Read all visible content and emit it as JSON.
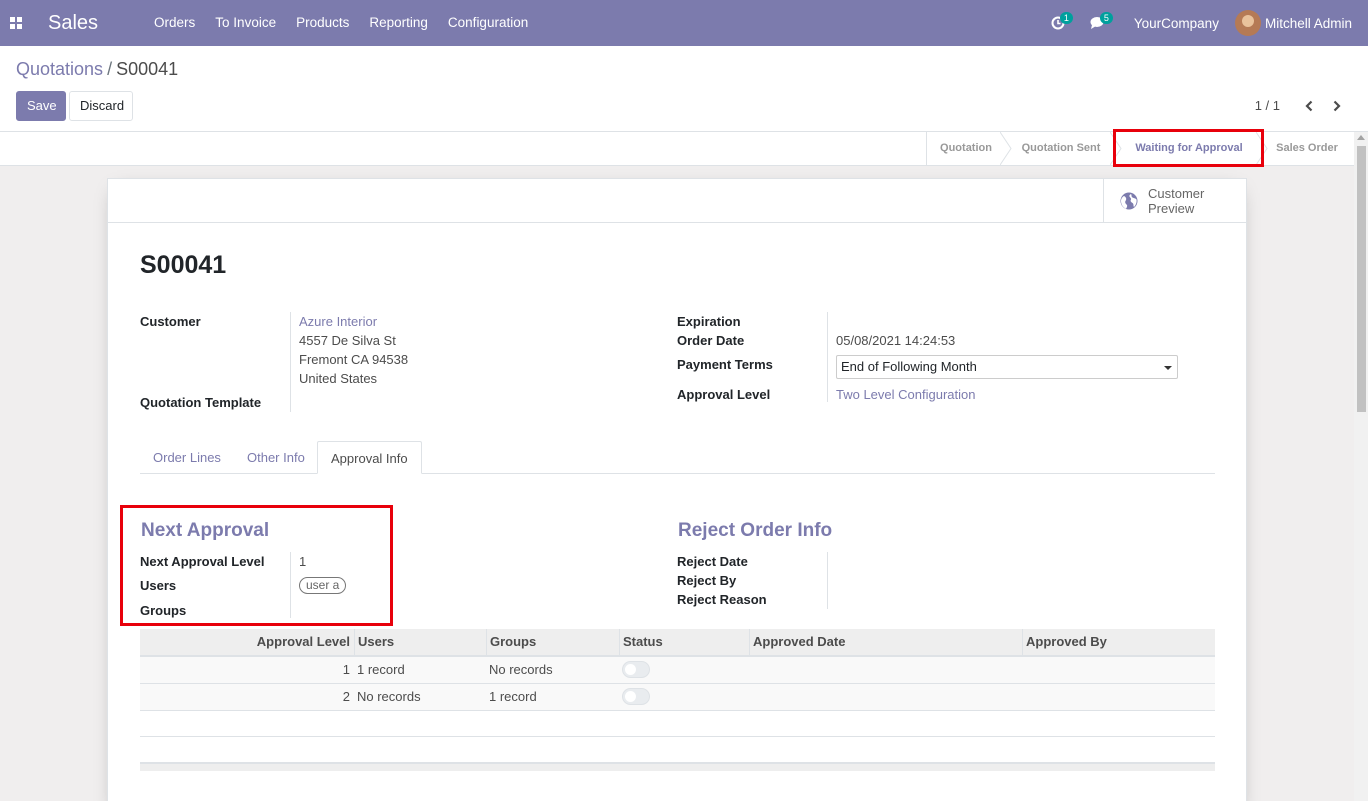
{
  "navbar": {
    "app_name": "Sales",
    "menu": [
      "Orders",
      "To Invoice",
      "Products",
      "Reporting",
      "Configuration"
    ],
    "activity_count": "1",
    "message_count": "5",
    "company": "YourCompany",
    "user": "Mitchell Admin",
    "brand_color": "#7c7bad"
  },
  "breadcrumb": {
    "parent": "Quotations",
    "separator": "/",
    "current": "S00041"
  },
  "buttons": {
    "save": "Save",
    "discard": "Discard"
  },
  "pager": {
    "value": "1 / 1"
  },
  "statusbar": {
    "steps": [
      "Quotation",
      "Quotation Sent",
      "Waiting for Approval",
      "Sales Order"
    ],
    "active": "Waiting for Approval"
  },
  "smart_button": {
    "label": "Customer Preview",
    "icon": "globe-icon"
  },
  "record": {
    "name": "S00041",
    "customer_label": "Customer",
    "customer_name": "Azure Interior",
    "address_line1": "4557 De Silva St",
    "address_line2": "Fremont CA 94538",
    "address_line3": "United States",
    "quotation_template_label": "Quotation Template",
    "expiration_label": "Expiration",
    "order_date_label": "Order Date",
    "order_date": "05/08/2021 14:24:53",
    "payment_terms_label": "Payment Terms",
    "payment_terms": "End of Following Month",
    "approval_level_label": "Approval Level",
    "approval_level": "Two Level Configuration"
  },
  "tabs": [
    "Order Lines",
    "Other Info",
    "Approval Info"
  ],
  "active_tab": "Approval Info",
  "next_approval": {
    "title": "Next Approval",
    "level_label": "Next Approval Level",
    "level_value": "1",
    "users_label": "Users",
    "user_tag": "user a",
    "groups_label": "Groups"
  },
  "reject_info": {
    "title": "Reject Order Info",
    "date_label": "Reject Date",
    "by_label": "Reject By",
    "reason_label": "Reject Reason"
  },
  "approval_table": {
    "columns": [
      "Approval Level",
      "Users",
      "Groups",
      "Status",
      "Approved Date",
      "Approved By"
    ],
    "rows": [
      {
        "level": "1",
        "users": "1 record",
        "groups": "No records",
        "status": false,
        "approved_date": "",
        "approved_by": ""
      },
      {
        "level": "2",
        "users": "No records",
        "groups": "1 record",
        "status": false,
        "approved_date": "",
        "approved_by": ""
      }
    ]
  },
  "highlight_color": "#e8000b"
}
